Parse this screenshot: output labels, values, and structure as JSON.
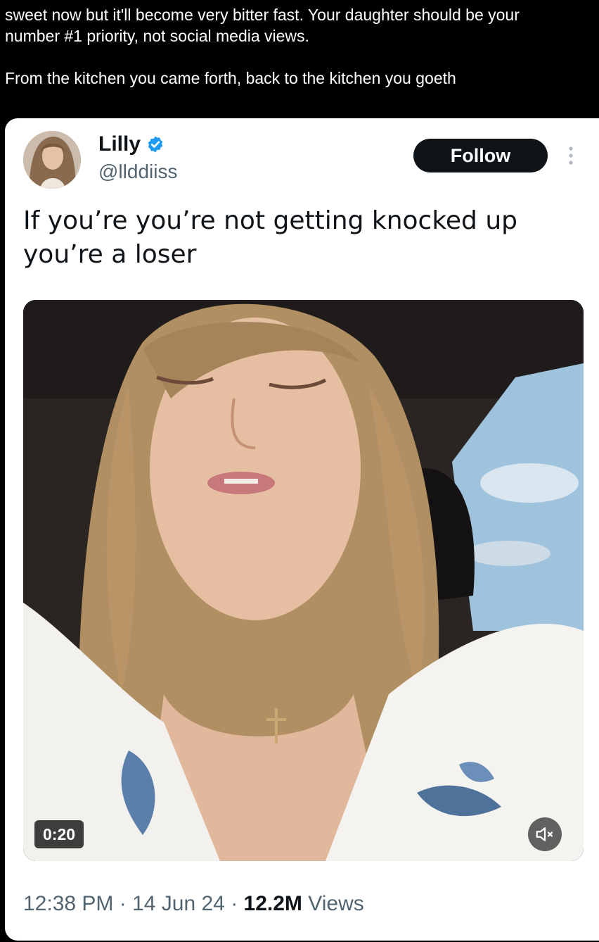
{
  "quote": {
    "line1": "sweet now but it'll become very bitter fast. Your daughter should be your",
    "line2": "number #1 priority, not social media views.",
    "line3": "From the kitchen you came forth, back to the kitchen you goeth"
  },
  "tweet": {
    "author_name": "Lilly",
    "handle": "@llddiiss",
    "follow_label": "Follow",
    "text_line1": "If you’re you’re not getting knocked up",
    "text_line2": "you’re a loser",
    "video_duration": "0:20",
    "time": "12:38 PM",
    "sep1": " · ",
    "date": "14 Jun 24",
    "sep2": " · ",
    "views_count": "12.2M",
    "views_label": " Views"
  },
  "icons": {
    "verified": "verified-badge-icon",
    "more": "more-options-icon",
    "mute": "muted-speaker-icon"
  },
  "colors": {
    "background": "#000000",
    "card": "#ffffff",
    "primary_text": "#0f1419",
    "secondary_text": "#536471",
    "verified_blue": "#1d9bf0",
    "follow_button": "#0f1419"
  }
}
